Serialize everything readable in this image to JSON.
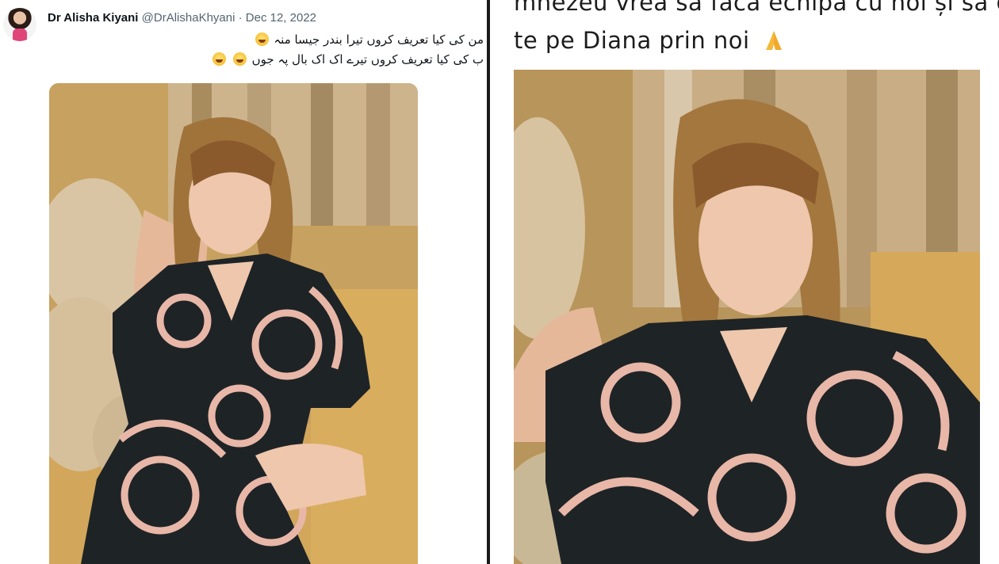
{
  "left_tweet": {
    "display_name": "Dr Alisha Kiyani",
    "handle": "@DrAlishaKhyani",
    "separator": "·",
    "date": "Dec 12, 2022",
    "line1": "من کی کیا تعریف کروں تیرا بندر جیسا منہ",
    "line2": "ب کی کیا تعریف کروں تیرے اک اک بال پہ جوں",
    "emoji_icon": "grinning-face-icon"
  },
  "right_post": {
    "caption_line1": "mnezeu vrea sa faca echipa cu noi și să d",
    "caption_line2": "te pe Diana prin noi",
    "caption_icon": "praying-hands-icon"
  },
  "colors": {
    "name": "#0f1419",
    "secondary": "#536471",
    "divider": "#1a1a1a",
    "pajama": "#1e2326",
    "pattern": "#e8b7a8"
  }
}
